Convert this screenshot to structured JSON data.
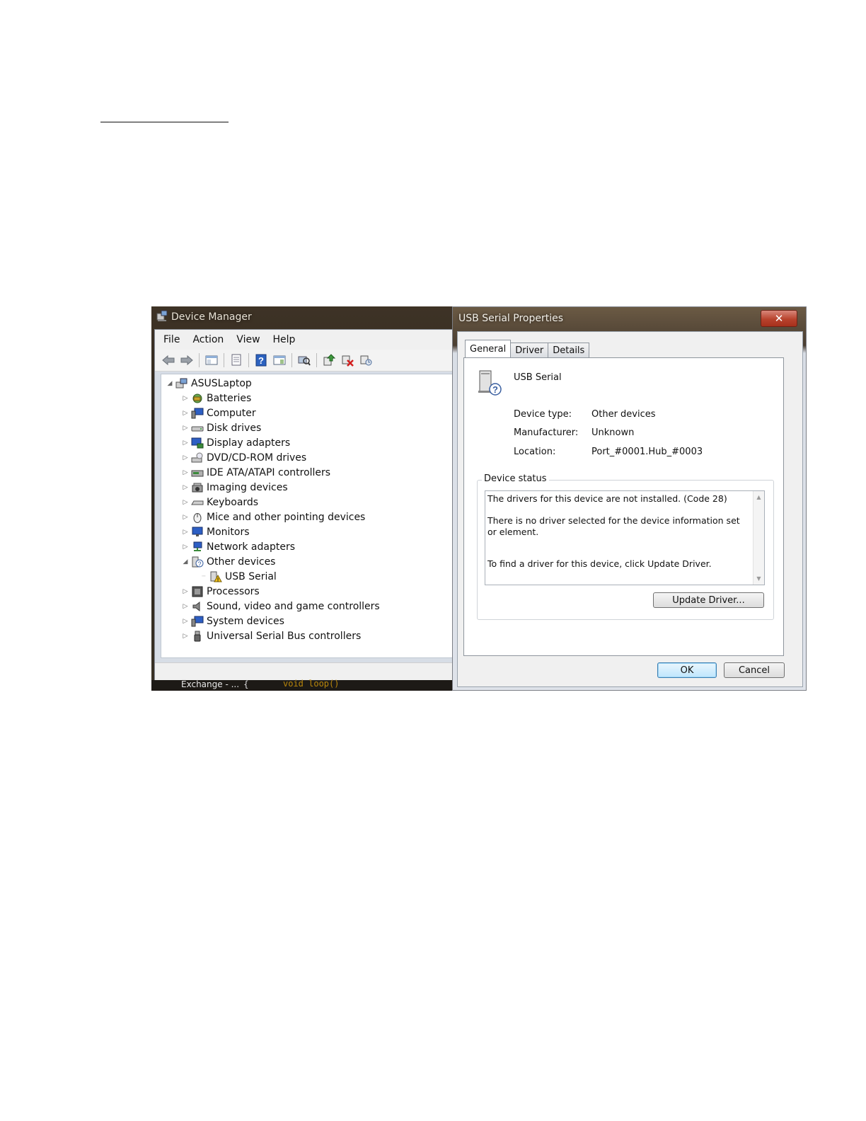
{
  "device_manager": {
    "title": "Device Manager",
    "menu": [
      "File",
      "Action",
      "View",
      "Help"
    ],
    "toolbar_icons": [
      "back-arrow-icon",
      "forward-arrow-icon",
      "show-hide-console-tree-icon",
      "properties-icon",
      "help-icon",
      "action-pane-icon",
      "scan-hardware-icon",
      "update-driver-icon",
      "uninstall-icon",
      "disable-device-icon"
    ],
    "tree": {
      "root": "ASUSLaptop",
      "items": [
        {
          "label": "Batteries",
          "icon": "battery-icon"
        },
        {
          "label": "Computer",
          "icon": "computer-icon"
        },
        {
          "label": "Disk drives",
          "icon": "disk-drive-icon"
        },
        {
          "label": "Display adapters",
          "icon": "display-adapter-icon"
        },
        {
          "label": "DVD/CD-ROM drives",
          "icon": "dvd-drive-icon"
        },
        {
          "label": "IDE ATA/ATAPI controllers",
          "icon": "ide-controller-icon"
        },
        {
          "label": "Imaging devices",
          "icon": "camera-icon"
        },
        {
          "label": "Keyboards",
          "icon": "keyboard-icon"
        },
        {
          "label": "Mice and other pointing devices",
          "icon": "mouse-icon"
        },
        {
          "label": "Monitors",
          "icon": "monitor-icon"
        },
        {
          "label": "Network adapters",
          "icon": "network-adapter-icon"
        },
        {
          "label": "Other devices",
          "icon": "unknown-device-icon"
        },
        {
          "label": "USB Serial",
          "icon": "warning-device-icon"
        },
        {
          "label": "Processors",
          "icon": "processor-icon"
        },
        {
          "label": "Sound, video and game controllers",
          "icon": "speaker-icon"
        },
        {
          "label": "System devices",
          "icon": "system-devices-icon"
        },
        {
          "label": "Universal Serial Bus controllers",
          "icon": "usb-icon"
        }
      ]
    },
    "taskbar": {
      "item1": "Exchange - ...",
      "item2": "{",
      "item3": "void loop()"
    }
  },
  "properties_dialog": {
    "title": "USB Serial Properties",
    "close_label": "✕",
    "tabs": [
      "General",
      "Driver",
      "Details"
    ],
    "device_name": "USB Serial",
    "props": [
      {
        "label": "Device type:",
        "value": "Other devices"
      },
      {
        "label": "Manufacturer:",
        "value": "Unknown"
      },
      {
        "label": "Location:",
        "value": "Port_#0001.Hub_#0003"
      }
    ],
    "status_group_label": "Device status",
    "status_lines": [
      "The drivers for this device are not installed. (Code 28)",
      "There is no driver selected for the device information set or element.",
      "To find a driver for this device, click Update Driver."
    ],
    "update_driver_label": "Update Driver...",
    "ok_label": "OK",
    "cancel_label": "Cancel"
  }
}
